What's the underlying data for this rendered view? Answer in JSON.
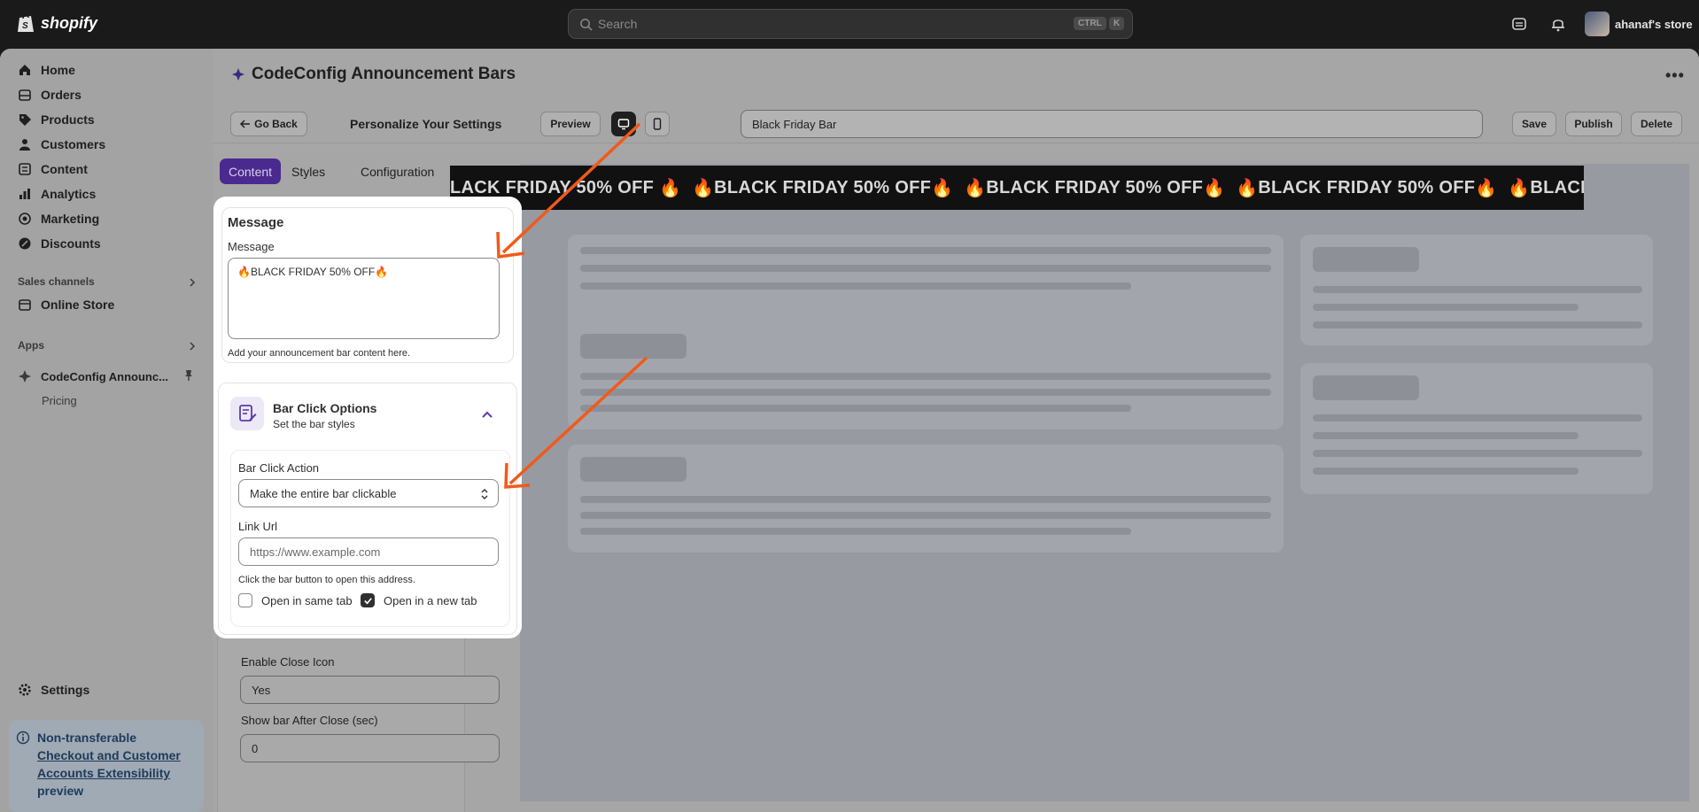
{
  "topbar": {
    "logo_text": "shopify",
    "search_placeholder": "Search",
    "shortcut_ctrl": "CTRL",
    "shortcut_k": "K",
    "store_name": "ahanaf's store"
  },
  "sidebar": {
    "items": [
      {
        "label": "Home",
        "icon": "home-icon"
      },
      {
        "label": "Orders",
        "icon": "orders-icon"
      },
      {
        "label": "Products",
        "icon": "tag-icon"
      },
      {
        "label": "Customers",
        "icon": "person-icon"
      },
      {
        "label": "Content",
        "icon": "content-icon"
      },
      {
        "label": "Analytics",
        "icon": "chart-icon"
      },
      {
        "label": "Marketing",
        "icon": "target-icon"
      },
      {
        "label": "Discounts",
        "icon": "discount-icon"
      }
    ],
    "sales_channels_label": "Sales channels",
    "online_store": "Online Store",
    "apps_label": "Apps",
    "app_name": "CodeConfig Announc...",
    "app_sub": "Pricing",
    "settings": "Settings",
    "notice": {
      "title": "Non-transferable",
      "link": "Checkout and Customer Accounts Extensibility",
      "tail": "preview"
    }
  },
  "page": {
    "title": "CodeConfig Announcement Bars",
    "more": "•••"
  },
  "toolbar": {
    "go_back": "Go Back",
    "heading": "Personalize Your Settings",
    "preview": "Preview",
    "bar_name": "Black Friday Bar",
    "save": "Save",
    "publish": "Publish",
    "delete": "Delete"
  },
  "tabs": [
    "Content",
    "Styles",
    "Configuration"
  ],
  "message_card": {
    "heading": "Message",
    "field_label": "Message",
    "value": "🔥BLACK FRIDAY 50% OFF🔥",
    "help": "Add your announcement bar content here."
  },
  "bar_click": {
    "title": "Bar Click Options",
    "subtitle": "Set the bar styles",
    "action_label": "Bar Click Action",
    "action_value": "Make the entire bar clickable",
    "link_label": "Link Url",
    "link_placeholder": "https://www.example.com",
    "link_help": "Click the bar button to open this address.",
    "same_tab": "Open in same tab",
    "same_tab_checked": false,
    "new_tab": "Open in a new tab",
    "new_tab_checked": true
  },
  "dimmed_fields": {
    "close_icon_label": "Enable Close Icon",
    "close_icon_value": "Yes",
    "show_after_label": "Show bar After Close (sec)",
    "show_after_value": "0"
  },
  "ticker": {
    "text": "BLACK FRIDAY 50% OFF",
    "leading_partial": "LACK FRIDAY 50% OFF",
    "trailing_partial": "BLACK FR"
  },
  "colors": {
    "accent_purple": "#4a2a8e",
    "arrow_orange": "#f05a1a",
    "ticker_bg": "#111111"
  }
}
